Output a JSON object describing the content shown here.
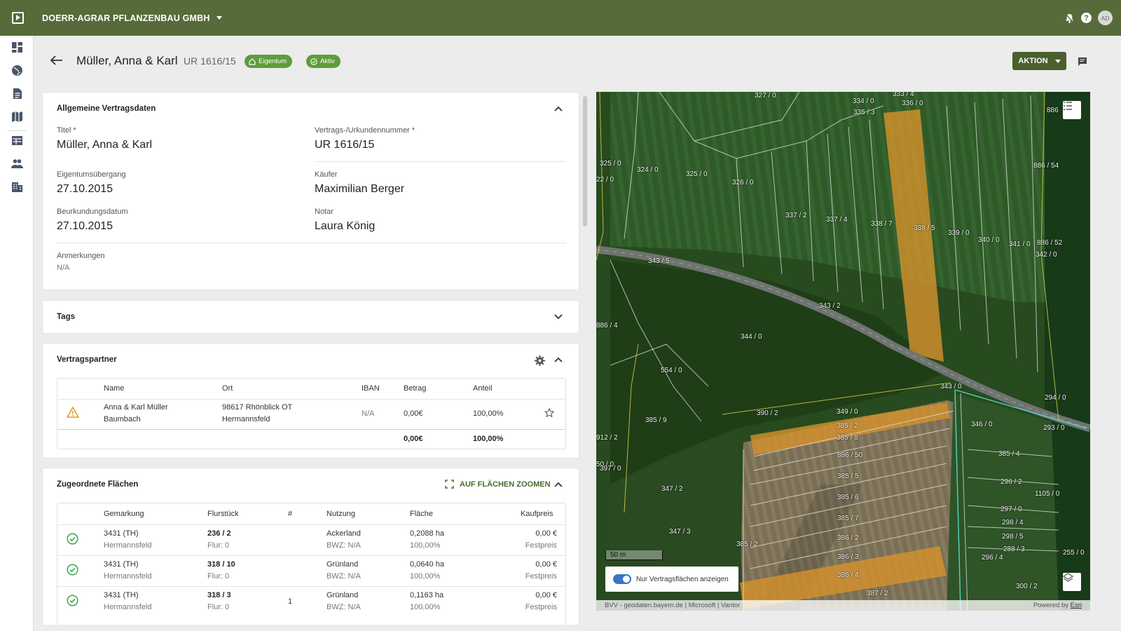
{
  "topbar": {
    "company": "DOERR-AGRAR PFLANZENBAU GMBH",
    "avatar": "AD"
  },
  "sidebar": {
    "items": [
      "dashboard-icon",
      "globe-icon",
      "document-icon",
      "map-icon",
      "table-icon",
      "people-icon",
      "building-icon"
    ]
  },
  "header": {
    "title": "Müller, Anna & Karl",
    "subtitle": "UR 1616/15",
    "badge_ownership": "Eigentum",
    "badge_status": "Aktiv",
    "action_label": "AKTION"
  },
  "general": {
    "title": "Allgemeine Vertragsdaten",
    "fields": [
      {
        "label": "Titel *",
        "value": "Müller, Anna & Karl"
      },
      {
        "label": "Vertrags-/Urkundennummer *",
        "value": "UR 1616/15"
      },
      {
        "label": "Eigentumsübergang",
        "value": "27.10.2015"
      },
      {
        "label": "Käufer",
        "value": "Maximilian Berger"
      },
      {
        "label": "Beurkundungsdatum",
        "value": "27.10.2015"
      },
      {
        "label": "Notar",
        "value": "Laura König"
      },
      {
        "label": "Anmerkungen",
        "value": "N/A"
      }
    ]
  },
  "tags": {
    "title": "Tags"
  },
  "partners": {
    "title": "Vertragspartner",
    "headers": [
      "Name",
      "Ort",
      "IBAN",
      "Betrag",
      "Anteil"
    ],
    "rows": [
      {
        "name1": "Anna & Karl Müller",
        "name2": "Baumbach",
        "ort1": "98617 Rhönblick OT",
        "ort2": "Hermannsfeld",
        "iban": "N/A",
        "betrag": "0,00€",
        "anteil": "100,00%"
      }
    ],
    "total_betrag": "0,00€",
    "total_anteil": "100,00%"
  },
  "areas": {
    "title": "Zugeordnete Flächen",
    "zoom_label": "AUF FLÄCHEN ZOOMEN",
    "headers": [
      "Gemarkung",
      "Flurstück",
      "#",
      "Nutzung",
      "Fläche",
      "Kaufpreis"
    ],
    "rows": [
      {
        "gem1": "3431 (TH)",
        "gem2": "Hermannsfeld",
        "fl1": "236 / 2",
        "fl2": "Flur: 0",
        "num": "",
        "nut1": "Ackerland",
        "nut2": "BWZ: N/A",
        "fla1": "0,2088 ha",
        "fla2": "100,00%",
        "kp1": "0,00 €",
        "kp2": "Festpreis"
      },
      {
        "gem1": "3431 (TH)",
        "gem2": "Hermannsfeld",
        "fl1": "318 / 10",
        "fl2": "Flur: 0",
        "num": "",
        "nut1": "Grünland",
        "nut2": "BWZ: N/A",
        "fla1": "0,0640 ha",
        "fla2": "100,00%",
        "kp1": "0,00 €",
        "kp2": "Festpreis"
      },
      {
        "gem1": "3431 (TH)",
        "gem2": "Hermannsfeld",
        "fl1": "318 / 3",
        "fl2": "Flur: 0",
        "num": "1",
        "nut1": "Grünland",
        "nut2": "BWZ: N/A",
        "fla1": "0,1163 ha",
        "fla2": "100,00%",
        "kp1": "0,00 €",
        "kp2": "Festpreis"
      }
    ]
  },
  "map": {
    "scale": "50 m",
    "toggle_label": "Nur Vertragsflächen anzeigen",
    "attribution": "BVV - geodaten.bayern.de | Microsoft | Vantor",
    "powered_prefix": "Powered by",
    "powered_brand": "Esri",
    "parcel_labels": [
      "327 / 0",
      "334 / 0",
      "333 / 4",
      "336 / 0",
      "335 / 3",
      "886",
      "325 / 0",
      "324 / 0",
      "325 / 0",
      "326 / 0",
      "886 / 54",
      "22 / 0",
      "337 / 2",
      "337 / 4",
      "338 / 7",
      "338 / 5",
      "339 / 0",
      "340 / 0",
      "341 / 0",
      "886 / 52",
      "342 / 0",
      "343 / 5",
      "343 / 2",
      "344 / 0",
      "886 / 4",
      "554 / 0",
      "343 / 0",
      "390 / 2",
      "349 / 0",
      "385 / 2",
      "385 / 8",
      "385 / 9",
      "346 / 0",
      "293 / 0",
      "912 / 2",
      "886 / 50",
      "385 / 4",
      "294 / 0",
      "50 / 0",
      "385 / 5",
      "296 / 2",
      "397 / 0",
      "347 / 2",
      "385 / 6",
      "1105 / 0",
      "297 / 0",
      "385 / 7",
      "298 / 4",
      "347 / 3",
      "386 / 2",
      "298 / 5",
      "386 / 3",
      "288 / 3",
      "255 / 0",
      "296 / 4",
      "386 / 4",
      "300 / 2",
      "387 / 2",
      "385 / 2"
    ]
  },
  "colors": {
    "topbar": "#566b39",
    "accent_green": "#5e9d3a",
    "action_button": "#4a5f2e",
    "contract_area": "#d6922c"
  }
}
